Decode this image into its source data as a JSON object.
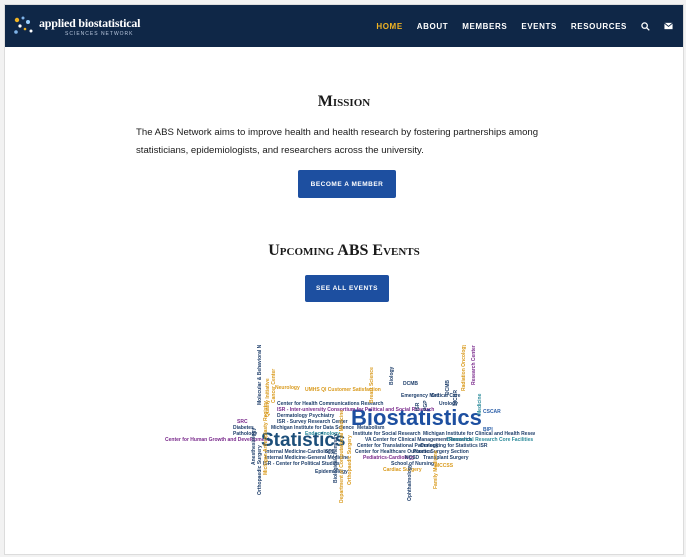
{
  "header": {
    "logo": {
      "name": "applied biostatistical",
      "tagline": "SCIENCES NETWORK"
    },
    "nav": [
      {
        "label": "HOME",
        "active": true
      },
      {
        "label": "ABOUT",
        "active": false
      },
      {
        "label": "MEMBERS",
        "active": false
      },
      {
        "label": "EVENTS",
        "active": false
      },
      {
        "label": "RESOURCES",
        "active": false
      }
    ],
    "icons": [
      "search-icon",
      "envelope-icon"
    ]
  },
  "mission": {
    "title": "Mission",
    "text": "The ABS Network aims to improve health and health research by fostering partnerships among statisticians, epidemiologists, and researchers across the university.",
    "button_label": "BECOME A MEMBER"
  },
  "events": {
    "title": "Upcoming ABS Events",
    "button_label": "SEE ALL EVENTS"
  },
  "colors": {
    "navy": "#0f2747",
    "accent": "#f0b323",
    "button": "#1d4fa0"
  }
}
